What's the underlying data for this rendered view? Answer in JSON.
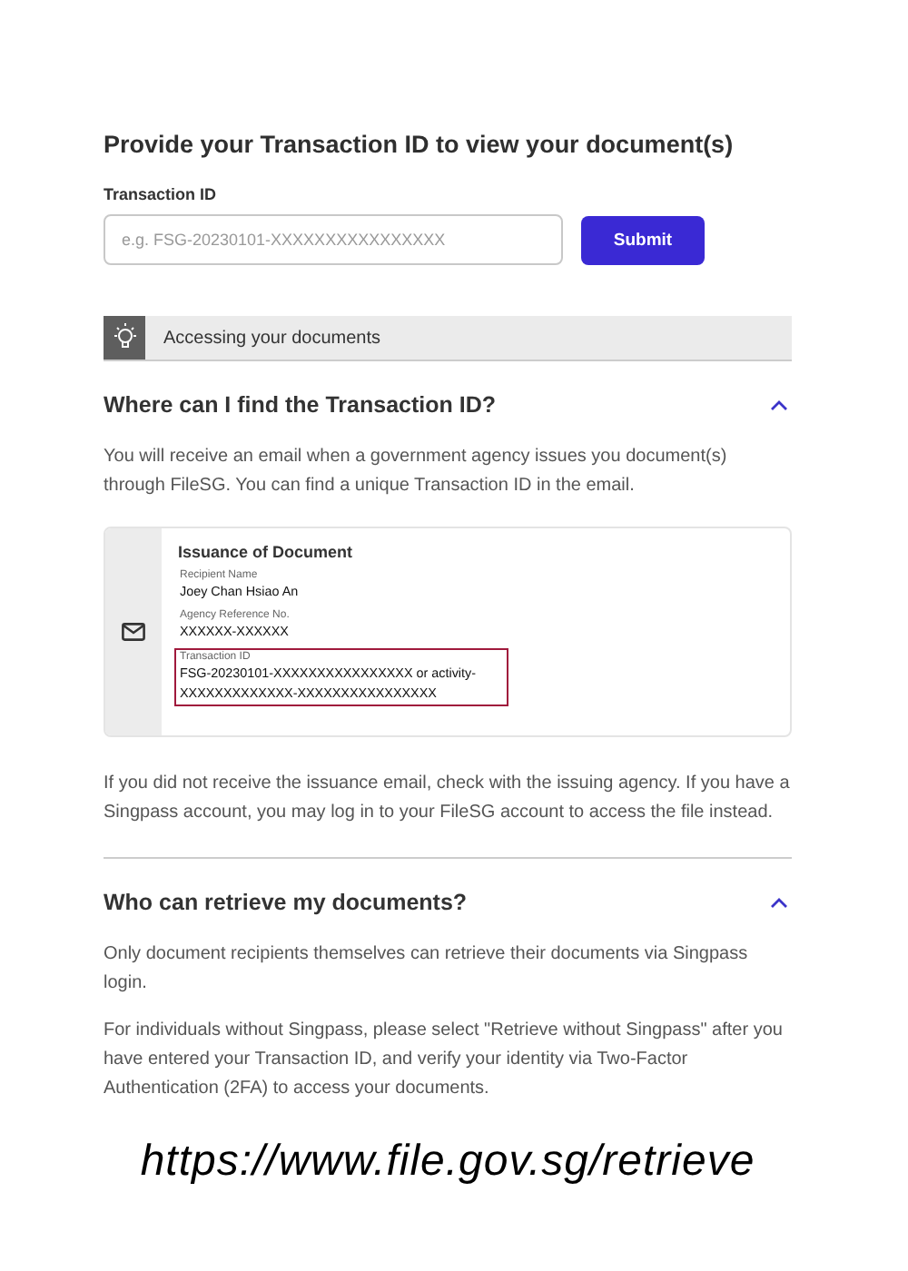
{
  "heading": "Provide your Transaction ID to view your document(s)",
  "transaction_field": {
    "label": "Transaction ID",
    "placeholder": "e.g. FSG-20230101-XXXXXXXXXXXXXXXX"
  },
  "submit_button": "Submit",
  "tip_bar": {
    "title": "Accessing your documents"
  },
  "faq": [
    {
      "question": "Where can I find the Transaction ID?",
      "expanded": true,
      "blocks": [
        {
          "kind": "text",
          "text": "You will receive an email when a government agency issues you document(s) through FileSG. You can find a unique Transaction ID in the email."
        },
        {
          "kind": "email-example",
          "title": "Issuance of Document",
          "fields": [
            {
              "label": "Recipient Name",
              "value": "Joey Chan Hsiao An",
              "highlighted": false
            },
            {
              "label": "Agency Reference No.",
              "value": "XXXXXX-XXXXXX",
              "highlighted": false
            },
            {
              "label": "Transaction ID",
              "value": "FSG-20230101-XXXXXXXXXXXXXXXX or activity-XXXXXXXXXXXXX-XXXXXXXXXXXXXXXX",
              "highlighted": true
            }
          ]
        },
        {
          "kind": "text",
          "text": "If you did not receive the issuance email, check with the issuing agency. If you have a Singpass account, you may log in to your FileSG account to access the file instead."
        }
      ]
    },
    {
      "question": "Who can retrieve my documents?",
      "expanded": true,
      "blocks": [
        {
          "kind": "text",
          "text": "Only document recipients themselves can retrieve their documents via Singpass login."
        },
        {
          "kind": "text",
          "text": "For individuals without Singpass, please select \"Retrieve without Singpass\" after you have entered your Transaction ID, and verify your identity via Two-Factor Authentication (2FA) to access your documents."
        }
      ]
    }
  ],
  "caption": "https://www.file.gov.sg/retrieve"
}
